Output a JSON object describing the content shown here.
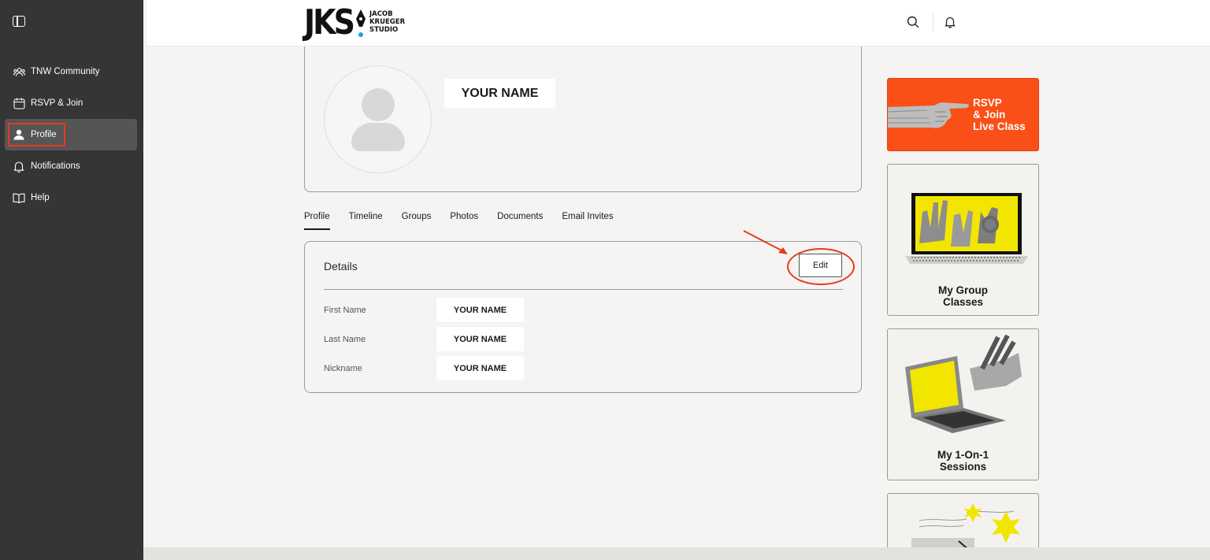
{
  "sidebar": {
    "items": [
      {
        "label": "TNW Community",
        "icon": "community-icon"
      },
      {
        "label": "RSVP & Join",
        "icon": "calendar-icon"
      },
      {
        "label": "Profile",
        "icon": "user-icon",
        "active": true
      },
      {
        "label": "Notifications",
        "icon": "bell-icon"
      },
      {
        "label": "Help",
        "icon": "book-icon"
      }
    ]
  },
  "header": {
    "logo_main": "JKS",
    "logo_sub": [
      "JACOB",
      "KRUEGER",
      "STUDIO"
    ]
  },
  "profile": {
    "display_name": "YOUR NAME"
  },
  "tabs": [
    "Profile",
    "Timeline",
    "Groups",
    "Photos",
    "Documents",
    "Email Invites"
  ],
  "details": {
    "title": "Details",
    "edit_label": "Edit",
    "fields": [
      {
        "label": "First Name",
        "value": "YOUR NAME"
      },
      {
        "label": "Last Name",
        "value": "YOUR NAME"
      },
      {
        "label": "Nickname",
        "value": "YOUR NAME"
      }
    ]
  },
  "promos": {
    "rsvp": [
      "RSVP",
      "& Join",
      "Live Class"
    ],
    "group": [
      "My Group",
      "Classes"
    ],
    "one": [
      "My 1-On-1",
      "Sessions"
    ]
  },
  "colors": {
    "sidebar_bg": "#353535",
    "accent_orange": "#fa4f16",
    "highlight_red": "#e23b1e",
    "yellow": "#f2e600"
  }
}
